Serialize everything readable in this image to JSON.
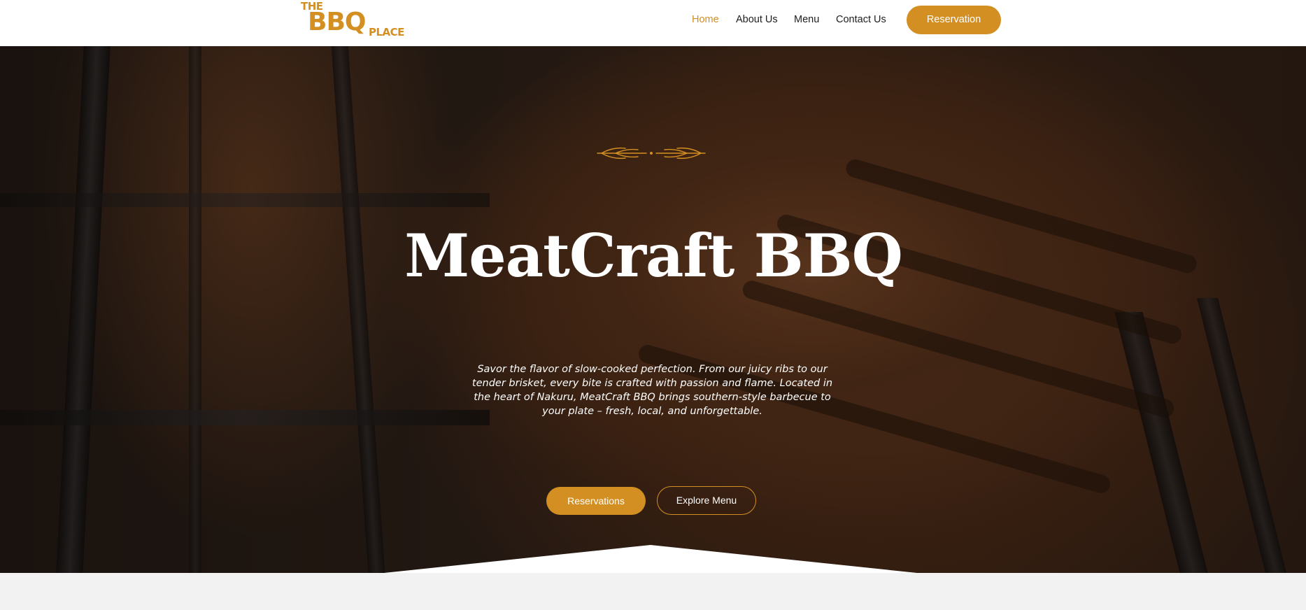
{
  "logo": {
    "line1": "THE",
    "line2": "BBQ",
    "line3": "PLACE"
  },
  "nav": {
    "items": [
      {
        "label": "Home",
        "active": true
      },
      {
        "label": "About Us",
        "active": false
      },
      {
        "label": "Menu",
        "active": false
      },
      {
        "label": "Contact Us",
        "active": false
      }
    ],
    "reservation_label": "Reservation"
  },
  "hero": {
    "title": "MeatCraft BBQ",
    "description": "Savor the flavor of slow-cooked perfection. From our juicy ribs to our tender brisket, every bite is crafted with passion and flame. Located in the heart of Nakuru, MeatCraft BBQ brings southern-style barbecue to your plate – fresh, local, and unforgettable.",
    "primary_button": "Reservations",
    "secondary_button": "Explore Menu"
  },
  "colors": {
    "accent": "#d38f22",
    "header_bg": "#ffffff",
    "page_bg": "#f2f2f2",
    "text_dark": "#1d1d1d"
  },
  "icons": [
    "wheat-ornament-icon"
  ]
}
